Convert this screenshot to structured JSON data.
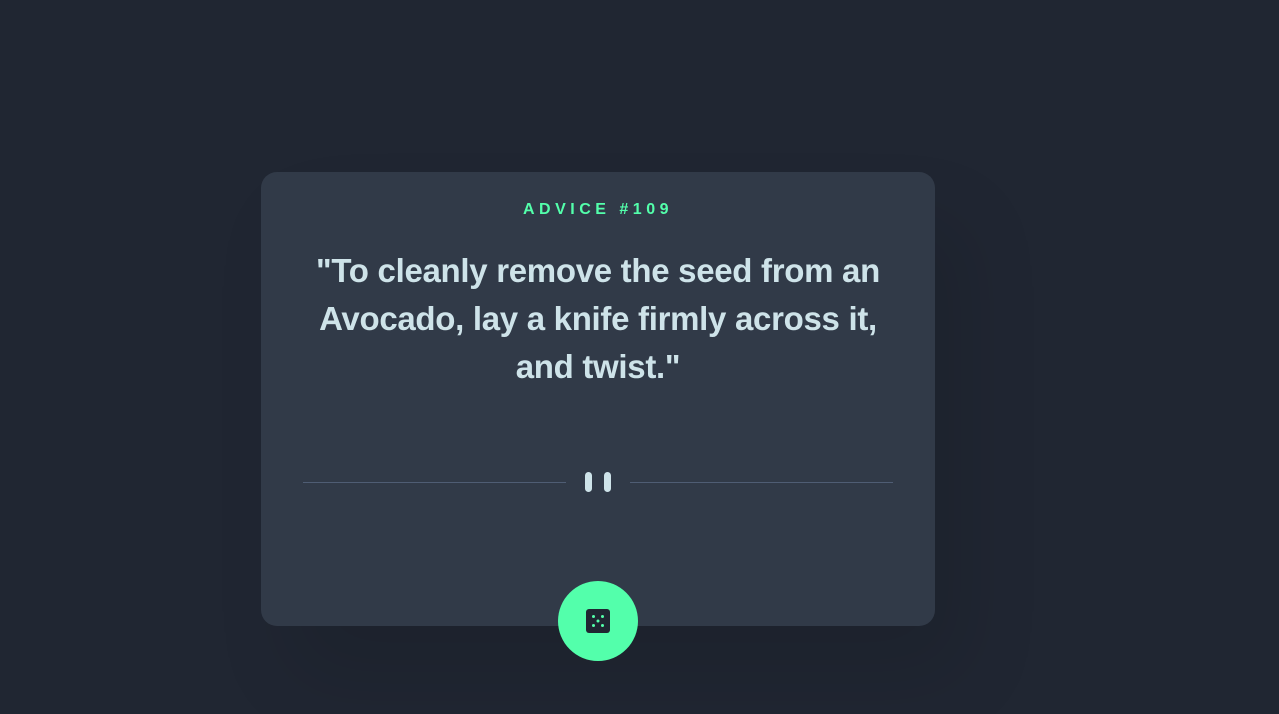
{
  "advice": {
    "label": "ADVICE #109",
    "text": "\"To cleanly remove the seed from an Avocado, lay a knife firmly across it, and twist.\""
  },
  "icons": {
    "divider": "pause-icon",
    "button": "dice-icon"
  },
  "colors": {
    "background": "#202632",
    "card": "#313a48",
    "accent": "#53ffab",
    "text": "#cee3e9",
    "divider": "#4f5d74"
  }
}
